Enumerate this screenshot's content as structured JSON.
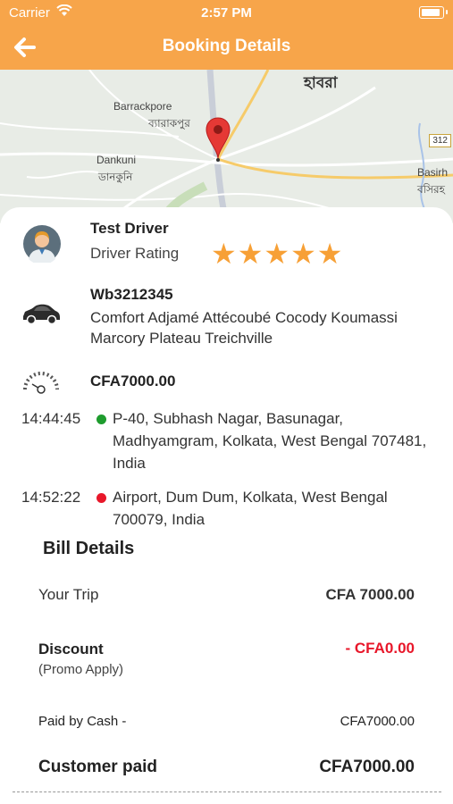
{
  "status_bar": {
    "carrier": "Carrier",
    "time": "2:57 PM"
  },
  "nav": {
    "title": "Booking Details"
  },
  "map": {
    "labels": {
      "habra": "হাবরা",
      "barrackpore": "Barrackpore",
      "barrackpore_bn": "ব্যারাকপুর",
      "dankuni": "Dankuni",
      "dankuni_bn": "ডানকুনি",
      "basirhat": "Basirh",
      "basirhat_bn": "বসিরহ",
      "road": "312"
    }
  },
  "driver": {
    "name": "Test Driver",
    "rating_label": "Driver Rating",
    "stars": 5
  },
  "vehicle": {
    "plate": "Wb3212345",
    "description": "Comfort Adjamé Attécoubé Cocody Koumassi Marcory Plateau Treichville"
  },
  "fare": "CFA7000.00",
  "trip": {
    "pickup": {
      "time": "14:44:45",
      "address": "P-40, Subhash Nagar, Basunagar, Madhyamgram, Kolkata, West Bengal 707481, India",
      "color": "#1E9C2E"
    },
    "dropoff": {
      "time": "14:52:22",
      "address": "Airport, Dum Dum, Kolkata, West Bengal 700079, India",
      "color": "#E8172A"
    }
  },
  "bill": {
    "title": "Bill Details",
    "your_trip_label": "Your Trip",
    "your_trip_value": "CFA 7000.00",
    "discount_label": "Discount",
    "discount_note": "(Promo Apply)",
    "discount_value": "- CFA0.00",
    "paid_by_label": "Paid by Cash -",
    "paid_by_value": "CFA7000.00",
    "customer_paid_label": "Customer paid",
    "customer_paid_value": "CFA7000.00"
  },
  "colors": {
    "accent": "#F7A54A",
    "star": "#F7A036",
    "discount": "#E8172A"
  }
}
